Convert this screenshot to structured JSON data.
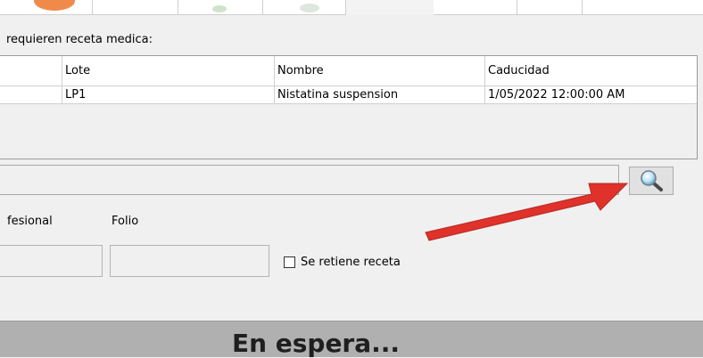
{
  "prescription_section": {
    "title": "requieren receta medica:"
  },
  "grid": {
    "columns": [
      "",
      "Lote",
      "Nombre",
      "Caducidad"
    ],
    "rows": [
      {
        "col0": "",
        "lote": "LP1",
        "nombre": "Nistatina suspension",
        "caducidad": "1/05/2022 12:00:00 AM"
      }
    ]
  },
  "search": {
    "value": "",
    "button_icon": "magnifier-icon"
  },
  "form": {
    "profesional_label": "fesional",
    "folio_label": "Folio",
    "profesional_value": "",
    "folio_value": "",
    "retain_checkbox_label": "Se retiene receta",
    "retain_checked": false
  },
  "annotation": {
    "arrow_color": "#e0312b"
  },
  "status": {
    "text": "En espera..."
  }
}
